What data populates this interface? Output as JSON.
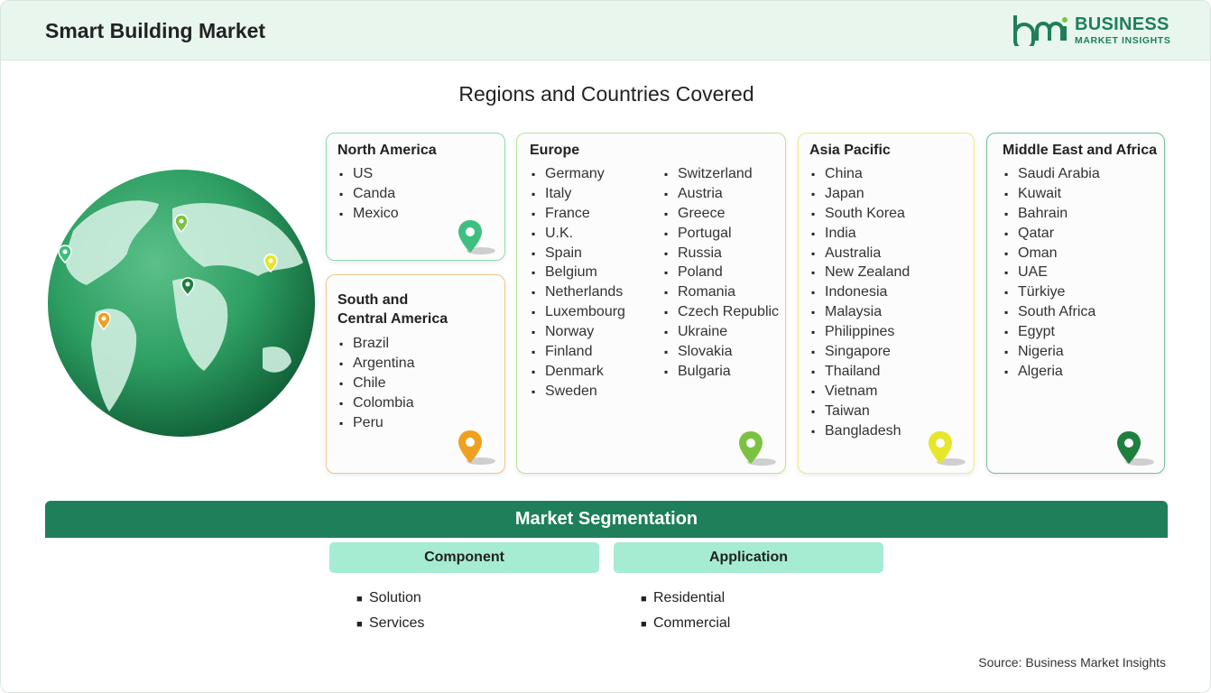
{
  "header": {
    "title": "Smart Building Market",
    "logo_line1": "BUSINESS",
    "logo_line2": "MARKET INSIGHTS"
  },
  "regions": {
    "title": "Regions and Countries Covered",
    "north_america": {
      "name": "North America",
      "countries": [
        "US",
        "Canda",
        "Mexico"
      ],
      "pin_color": "#3fbf7f"
    },
    "south_america": {
      "name_line1": "South and",
      "name_line2": "Central America",
      "countries": [
        "Brazil",
        "Argentina",
        "Chile",
        "Colombia",
        "Peru"
      ],
      "pin_color": "#f0a020"
    },
    "europe": {
      "name": "Europe",
      "countries_col1": [
        "Germany",
        "Italy",
        "France",
        "U.K.",
        "Spain",
        "Belgium",
        "Netherlands",
        "Luxembourg",
        "Norway",
        "Finland",
        "Denmark",
        "Sweden"
      ],
      "countries_col2": [
        "Switzerland",
        "Austria",
        "Greece",
        "Portugal",
        "Russia",
        "Poland",
        "Romania",
        "Czech Republic",
        "Ukraine",
        "Slovakia",
        "Bulgaria"
      ],
      "pin_color": "#7cc242"
    },
    "asia_pacific": {
      "name": "Asia Pacific",
      "countries": [
        "China",
        "Japan",
        "South Korea",
        "India",
        "Australia",
        "New Zealand",
        "Indonesia",
        "Malaysia",
        "Philippines",
        "Singapore",
        "Thailand",
        "Vietnam",
        "Taiwan",
        "Bangladesh"
      ],
      "pin_color": "#e6e62a"
    },
    "middle_east_africa": {
      "name": "Middle East and Africa",
      "countries": [
        "Saudi Arabia",
        "Kuwait",
        "Bahrain",
        "Qatar",
        "Oman",
        "UAE",
        "Türkiye",
        "South Africa",
        "Egypt",
        "Nigeria",
        "Algeria"
      ],
      "pin_color": "#1e7f3e"
    }
  },
  "segmentation": {
    "title": "Market Segmentation",
    "component": {
      "label": "Component",
      "items": [
        "Solution",
        "Services"
      ]
    },
    "application": {
      "label": "Application",
      "items": [
        "Residential",
        "Commercial"
      ]
    }
  },
  "footer": {
    "source": "Source: Business Market Insights"
  },
  "colors": {
    "brand": "#1e7f5a",
    "segment_header": "#a5ecd2",
    "header_bg": "#e8f6ee"
  }
}
